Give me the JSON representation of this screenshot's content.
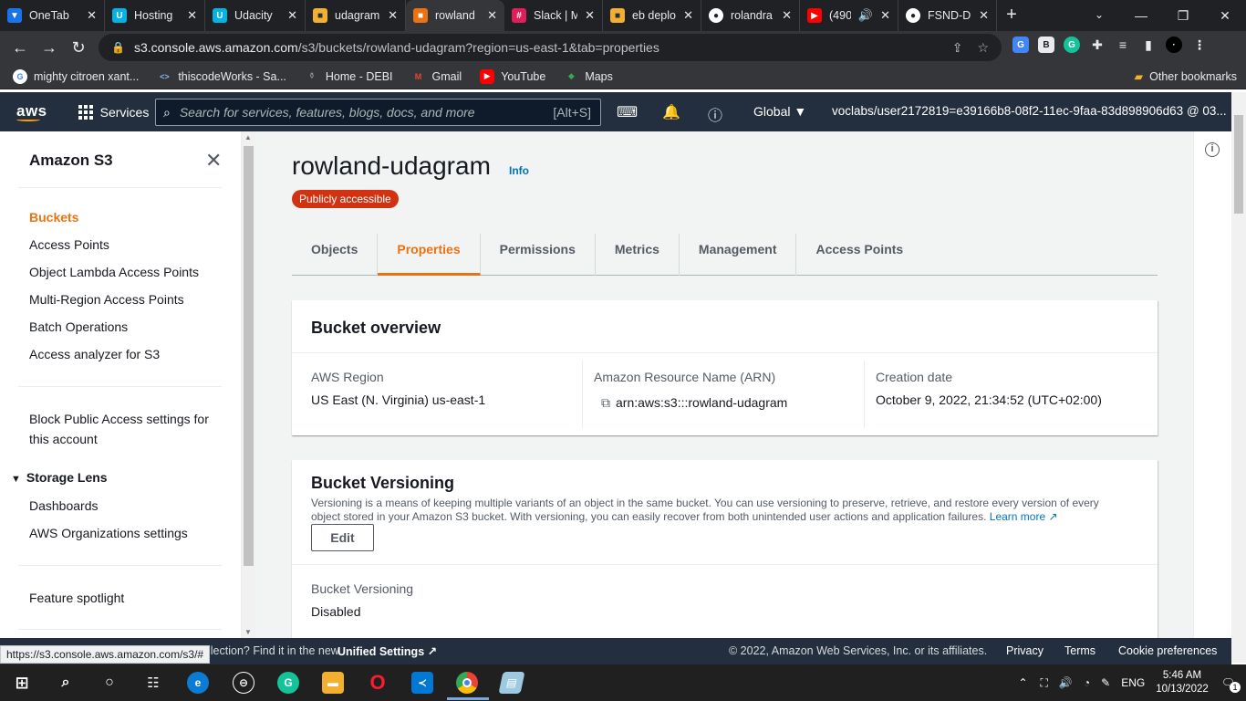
{
  "browser": {
    "tabs": [
      {
        "title": "OneTab",
        "icon": "onetab-icon",
        "color": "#1a73e8"
      },
      {
        "title": "Hosting",
        "icon": "udacity-icon",
        "color": "#02b3e4"
      },
      {
        "title": "Udacity",
        "icon": "udacity-icon",
        "color": "#02b3e4"
      },
      {
        "title": "udagram",
        "icon": "aws-box-icon",
        "color": "#f2b02e"
      },
      {
        "title": "rowland",
        "icon": "aws-box-icon",
        "color": "#ec7211",
        "active": true
      },
      {
        "title": "Slack | M",
        "icon": "slack-icon",
        "color": "#e01e5a"
      },
      {
        "title": "eb deplo",
        "icon": "aws-box-icon",
        "color": "#f2b02e"
      },
      {
        "title": "rolandra",
        "icon": "github-icon",
        "color": "#ffffff"
      },
      {
        "title": "(490",
        "icon": "youtube-icon",
        "color": "#ff0000"
      },
      {
        "title": "FSND-D",
        "icon": "github-icon",
        "color": "#ffffff"
      }
    ],
    "url_host": "s3.console.aws.amazon.com",
    "url_path": "/s3/buckets/rowland-udagram?region=us-east-1&tab=properties",
    "bookmarks": [
      {
        "label": "mighty citroen xant...",
        "icon": "google-icon"
      },
      {
        "label": "thiscodeWorks - Sa...",
        "icon": "code-icon"
      },
      {
        "label": "Home - DEBI",
        "icon": "debi-icon"
      },
      {
        "label": "Gmail",
        "icon": "gmail-icon"
      },
      {
        "label": "YouTube",
        "icon": "youtube-icon"
      },
      {
        "label": "Maps",
        "icon": "maps-icon"
      }
    ],
    "other_bookmarks": "Other bookmarks",
    "status_url": "https://s3.console.aws.amazon.com/s3/#"
  },
  "aws_header": {
    "logo": "aws",
    "services": "Services",
    "search_placeholder": "Search for services, features, blogs, docs, and more",
    "search_shortcut": "[Alt+S]",
    "region": "Global ▼",
    "account": "voclabs/user2172819=e39166b8-08f2-11ec-9faa-83d898906d63 @ 03... ▼"
  },
  "sidebar": {
    "title": "Amazon S3",
    "items": [
      {
        "label": "Buckets",
        "active": true
      },
      {
        "label": "Access Points"
      },
      {
        "label": "Object Lambda Access Points"
      },
      {
        "label": "Multi-Region Access Points"
      },
      {
        "label": "Batch Operations"
      },
      {
        "label": "Access analyzer for S3"
      }
    ],
    "block_public_line1": "Block Public Access settings for",
    "block_public_line2": "this account",
    "storage_lens": "Storage Lens",
    "storage_lens_items": [
      "Dashboards",
      "AWS Organizations settings"
    ],
    "feature_spotlight": "Feature spotlight"
  },
  "main": {
    "bucket_name": "rowland-udagram",
    "info": "Info",
    "badge": "Publicly accessible",
    "tabs": [
      "Objects",
      "Properties",
      "Permissions",
      "Metrics",
      "Management",
      "Access Points"
    ],
    "overview": {
      "title": "Bucket overview",
      "region_label": "AWS Region",
      "region_value": "US East (N. Virginia) us-east-1",
      "arn_label": "Amazon Resource Name (ARN)",
      "arn_value": "arn:aws:s3:::rowland-udagram",
      "date_label": "Creation date",
      "date_value": "October 9, 2022, 21:34:52 (UTC+02:00)"
    },
    "versioning": {
      "title": "Bucket Versioning",
      "desc_line1": "Versioning is a means of keeping multiple variants of an object in the same bucket. You can use versioning to preserve, retrieve, and restore every version of every",
      "desc_line2": "object stored in your Amazon S3 bucket. With versioning, you can easily recover from both unintended user actions and application failures.",
      "learn_more": "Learn more",
      "edit": "Edit",
      "status_label": "Bucket Versioning",
      "status_value": "Disabled"
    }
  },
  "footer": {
    "left_text": "llection? Find it in the new",
    "unified": "Unified Settings",
    "copyright": "© 2022, Amazon Web Services, Inc. or its affiliates.",
    "privacy": "Privacy",
    "terms": "Terms",
    "cookies": "Cookie preferences"
  },
  "taskbar": {
    "lang": "ENG",
    "time": "5:46 AM",
    "date": "10/13/2022",
    "notifications": "1"
  }
}
